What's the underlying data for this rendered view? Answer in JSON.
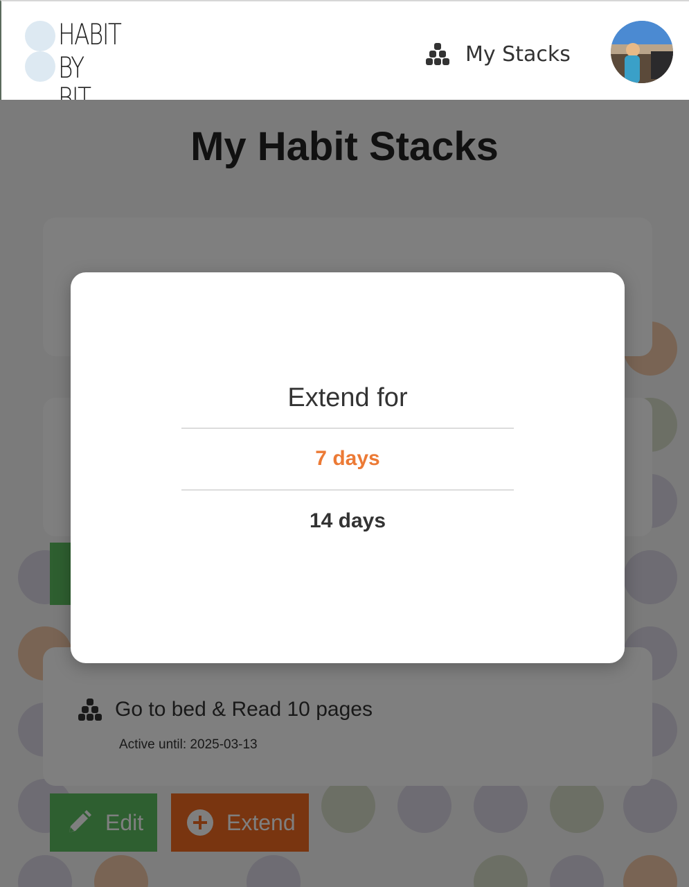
{
  "header": {
    "logo_line1": "HABIT",
    "logo_line2": "BY BIT",
    "nav_stacks_label": "My Stacks"
  },
  "page": {
    "title": "My Habit Stacks",
    "stacks": [
      {
        "title": "Go to bed & Read 10 pages",
        "active_until": "Active until: 2025-03-13"
      }
    ],
    "edit_label": "Edit",
    "extend_label": "Extend"
  },
  "modal": {
    "title": "Extend for",
    "options": [
      "7 days",
      "14 days"
    ],
    "selected_option": "7 days"
  },
  "colors": {
    "accent_orange": "#ec7a35",
    "extend_button": "#f26b21",
    "edit_button": "#5cbf60",
    "logo_dot": "#dde9f2",
    "text_dark": "#333333"
  },
  "icons": {
    "nav": "stack-icon",
    "edit_button": "pencil-icon",
    "extend_button": "plus-circle-icon"
  }
}
